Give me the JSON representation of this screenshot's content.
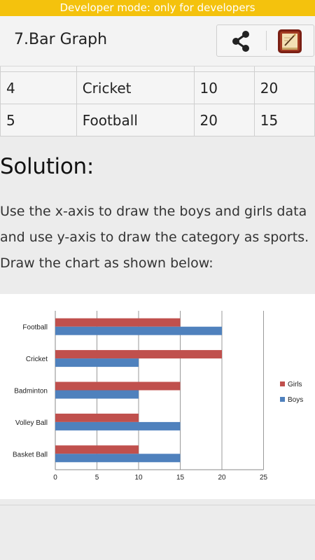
{
  "dev_banner": "Developer mode: only for developers",
  "app_bar": {
    "title": "7.Bar Graph",
    "share_icon": "share-icon",
    "book_icon": "book-icon"
  },
  "table": {
    "rows": [
      {
        "no": "4",
        "sport": "Cricket",
        "boys": "10",
        "girls": "20"
      },
      {
        "no": "5",
        "sport": "Football",
        "boys": "20",
        "girls": "15"
      }
    ]
  },
  "solution": {
    "heading": "Solution:",
    "line1": "Use the x-axis to draw the boys and girls data",
    "line2": "and use y-axis to draw the category as sports.",
    "line3": "Draw the chart as shown below:"
  },
  "chart_data": {
    "type": "bar",
    "orientation": "horizontal",
    "categories": [
      "Basket Ball",
      "Volley Ball",
      "Badminton",
      "Cricket",
      "Football"
    ],
    "series": [
      {
        "name": "Boys",
        "values": [
          15,
          15,
          10,
          10,
          20
        ],
        "color": "#4f81bd"
      },
      {
        "name": "Girls",
        "values": [
          10,
          10,
          15,
          20,
          15
        ],
        "color": "#c0504d"
      }
    ],
    "xlim": [
      0,
      25
    ],
    "xticks": [
      "0",
      "5",
      "10",
      "15",
      "20",
      "25"
    ],
    "grid": true,
    "legend": "right"
  }
}
